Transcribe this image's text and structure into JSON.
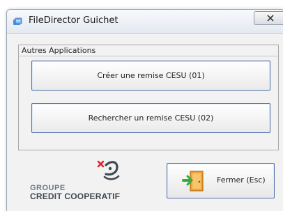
{
  "window": {
    "title": "FileDirector Guichet",
    "close_icon": "close-icon"
  },
  "panel": {
    "label": "Autres Applications",
    "buttons": [
      {
        "label": "Créer une remise CESU (01)"
      },
      {
        "label": "Rechercher un remise CESU (02)"
      }
    ]
  },
  "logo": {
    "line1": "GROUPE",
    "line2": "CREDIT COOPERATIF",
    "accent_color": "#e2252b",
    "icon": "group-logo-icon"
  },
  "exit_button": {
    "label": "Fermer (Esc)",
    "icon": "exit-door-icon"
  }
}
